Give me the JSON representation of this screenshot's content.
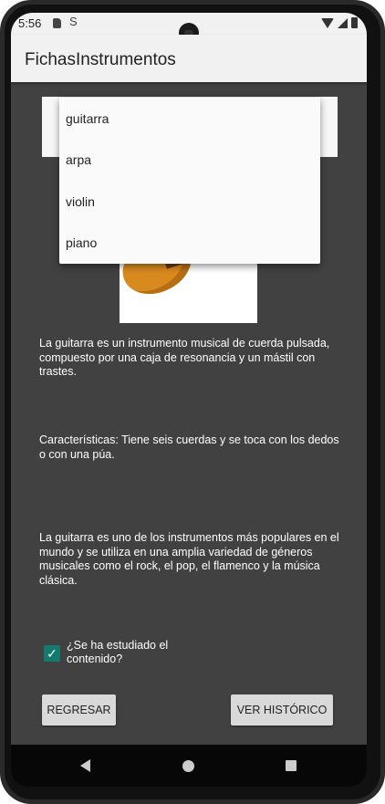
{
  "status": {
    "time": "5:56"
  },
  "app": {
    "title": "FichasInstrumentos"
  },
  "spinner": {
    "options": [
      "guitarra",
      "arpa",
      "violin",
      "piano"
    ]
  },
  "content": {
    "description": "La guitarra es un instrumento musical de cuerda pulsada, compuesto por una caja de resonancia y un mástil con trastes.",
    "features": "Características: Tiene seis cuerdas y se toca con los dedos o con una púa.",
    "extra": "La guitarra es uno de los instrumentos más populares en el mundo y se utiliza en una amplia variedad de géneros musicales como el rock, el pop, el flamenco y la música clásica."
  },
  "checkbox": {
    "label": "¿Se ha estudiado el contenido?",
    "checked": true
  },
  "buttons": {
    "back": "REGRESAR",
    "history": "VER HISTÓRICO"
  },
  "colors": {
    "background": "#414141",
    "appbar": "#f1f1f1",
    "accent": "#137a6e"
  },
  "icons": [
    "sd-card-icon",
    "sim-icon",
    "wifi-icon",
    "signal-icon",
    "battery-icon",
    "back-nav-icon",
    "home-nav-icon",
    "recents-nav-icon",
    "checkmark-icon"
  ]
}
